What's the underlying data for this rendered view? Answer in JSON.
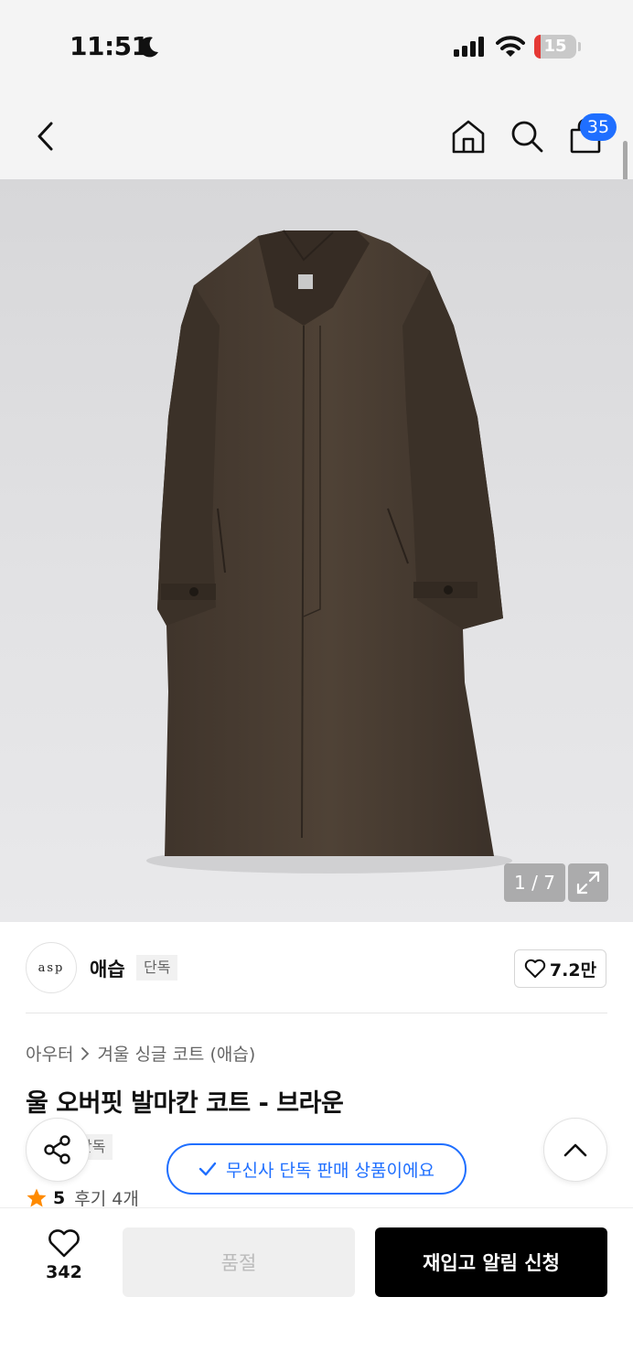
{
  "status_bar": {
    "time": "11:51",
    "battery": "15",
    "battery_level": 0.15
  },
  "header": {
    "cart_count": "35",
    "icons": [
      "back-icon",
      "home-icon",
      "search-icon",
      "shopping-bag-icon"
    ]
  },
  "gallery": {
    "counter": "1 / 7"
  },
  "brand": {
    "logo_text": "asp",
    "name": "애습",
    "tag": "단독",
    "likes": "7.2만"
  },
  "product": {
    "breadcrumb": [
      "아우터",
      "겨울 싱글 코트 (애습)"
    ],
    "title": "울 오버핏 발마칸 코트 - 브라운",
    "exclusive_tag": "단독",
    "rating": "5",
    "reviews": "후기 4개",
    "exclusive_notice": "무신사 단독 판매 상품이에요"
  },
  "bottom_bar": {
    "wish_count": "342",
    "soldout_label": "품절",
    "restock_label": "재입고 알림 신청"
  },
  "colors": {
    "accent": "#1f6fff",
    "star": "#ff8a00",
    "battery_low": "#e53935",
    "primary_button": "#000000"
  }
}
